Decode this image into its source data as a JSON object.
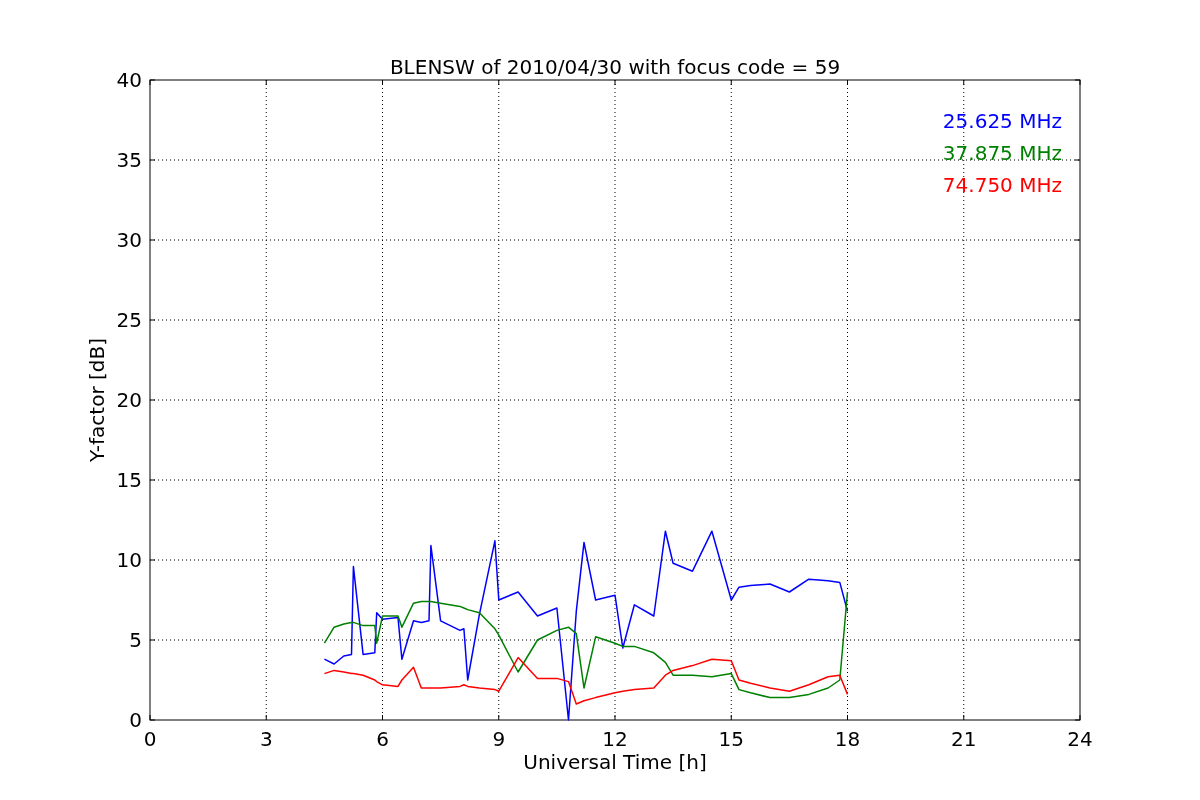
{
  "figure": {
    "chart_data": {
      "type": "line",
      "title": "BLENSW of 2010/04/30 with focus code = 59",
      "xlabel": "Universal Time [h]",
      "ylabel": "Y-factor [dB]",
      "x": [
        4.5,
        4.75,
        5,
        5.2,
        5.25,
        5.5,
        5.8,
        5.85,
        6,
        6.4,
        6.5,
        6.8,
        7,
        7.2,
        7.25,
        7.5,
        8,
        8.1,
        8.2,
        8.5,
        8.9,
        9,
        9.5,
        10,
        10.5,
        10.8,
        11,
        11.2,
        11.5,
        12,
        12.2,
        12.5,
        13,
        13.3,
        13.5,
        14,
        14.5,
        15,
        15.2,
        15.5,
        16,
        16.5,
        17,
        17.5,
        17.8,
        18
      ],
      "series": [
        {
          "name": "25.625 MHz",
          "color": "#0000ff",
          "values": [
            3.8,
            3.5,
            4.0,
            4.1,
            9.6,
            4.1,
            4.2,
            6.7,
            6.3,
            6.4,
            3.8,
            6.2,
            6.1,
            6.2,
            10.9,
            6.2,
            5.6,
            5.7,
            2.5,
            6.6,
            11.2,
            7.5,
            8.0,
            6.5,
            7.0,
            0,
            6.8,
            11.1,
            7.5,
            7.8,
            4.5,
            7.2,
            6.5,
            11.8,
            9.8,
            9.3,
            11.8,
            7.5,
            8.3,
            8.4,
            8.5,
            8.0,
            8.8,
            8.7,
            8.6,
            6.8
          ]
        },
        {
          "name": "37.875 MHz",
          "color": "#008000",
          "values": [
            4.8,
            5.8,
            6.0,
            6.1,
            6.1,
            5.9,
            5.9,
            4.8,
            6.5,
            6.5,
            5.8,
            7.3,
            7.4,
            7.4,
            7.4,
            7.3,
            7.1,
            7.0,
            6.9,
            6.7,
            5.7,
            5.3,
            3.0,
            5.0,
            5.6,
            5.8,
            5.4,
            2.0,
            5.2,
            4.8,
            4.6,
            4.6,
            4.2,
            3.6,
            2.8,
            2.8,
            2.7,
            2.9,
            1.9,
            1.7,
            1.4,
            1.4,
            1.6,
            2.0,
            2.5,
            8.0
          ]
        },
        {
          "name": "74.750 MHz",
          "color": "#ff0000",
          "values": [
            2.9,
            3.1,
            3.0,
            2.9,
            2.9,
            2.8,
            2.5,
            2.4,
            2.2,
            2.1,
            2.5,
            3.3,
            2.0,
            2.0,
            2.0,
            2.0,
            2.1,
            2.2,
            2.1,
            2.0,
            1.9,
            1.8,
            3.9,
            2.6,
            2.6,
            2.4,
            1.0,
            1.2,
            1.4,
            1.7,
            1.8,
            1.9,
            2.0,
            2.8,
            3.1,
            3.4,
            3.8,
            3.7,
            2.5,
            2.3,
            2.0,
            1.8,
            2.2,
            2.7,
            2.8,
            1.6
          ]
        }
      ],
      "xlim": [
        0,
        24
      ],
      "ylim": [
        0,
        40
      ],
      "xticks": [
        0,
        3,
        6,
        9,
        12,
        15,
        18,
        21,
        24
      ],
      "yticks": [
        0,
        5,
        10,
        15,
        20,
        25,
        30,
        35,
        40
      ],
      "grid": true
    }
  }
}
